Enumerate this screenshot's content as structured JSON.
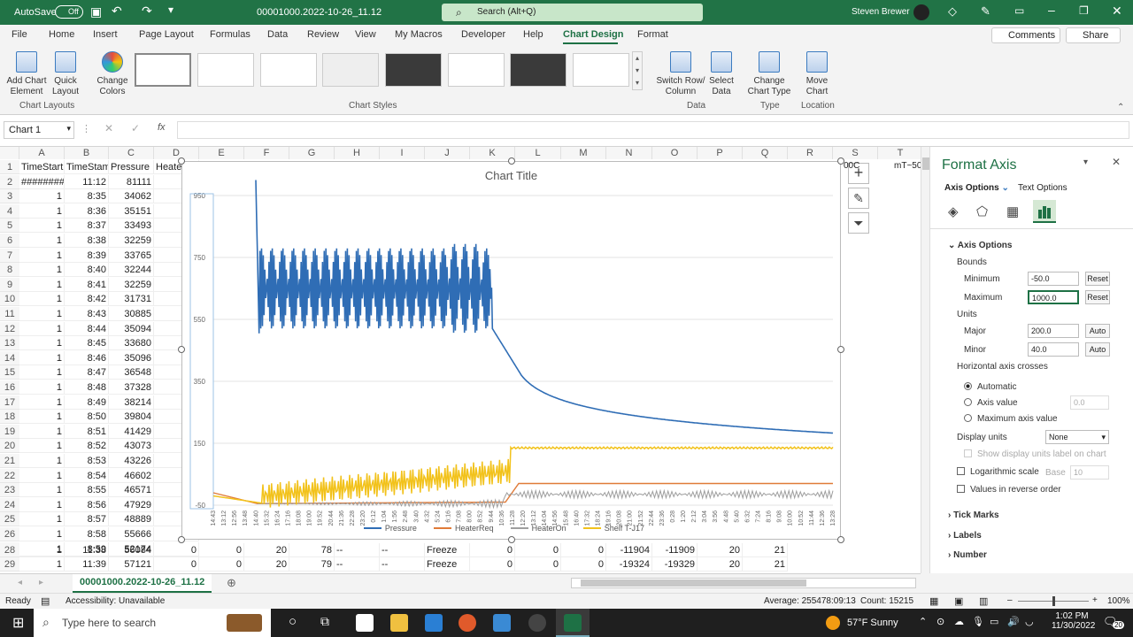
{
  "titlebar": {
    "autosave_label": "AutoSave",
    "autosave_state": "Off",
    "filename": "00001000.2022-10-26_11.12",
    "search_placeholder": "Search (Alt+Q)",
    "user": "Steven Brewer"
  },
  "ribbon_tabs": [
    "File",
    "Home",
    "Insert",
    "Page Layout",
    "Formulas",
    "Data",
    "Review",
    "View",
    "My Macros",
    "Developer",
    "Help",
    "Chart Design",
    "Format"
  ],
  "ribbon_actions": {
    "comments": "Comments",
    "share": "Share"
  },
  "ribbon": {
    "add_chart_element": "Add Chart Element",
    "quick_layout": "Quick Layout",
    "change_colors": "Change Colors",
    "switch_row_col": "Switch Row/ Column",
    "select_data": "Select Data",
    "change_chart_type": "Change Chart Type",
    "move_chart": "Move Chart",
    "group_chart_layouts": "Chart Layouts",
    "group_chart_styles": "Chart Styles",
    "group_data": "Data",
    "group_type": "Type",
    "group_location": "Location"
  },
  "formula": {
    "namebox": "Chart 1",
    "fx": "fx"
  },
  "columns": [
    "A",
    "B",
    "C",
    "D",
    "E",
    "F",
    "G",
    "H",
    "I",
    "J",
    "K",
    "L",
    "M",
    "N",
    "O",
    "P",
    "Q",
    "R",
    "S",
    "T"
  ],
  "rows": [
    [
      "1",
      "TimeStart",
      "TimeStam",
      "Pressure",
      "Heate"
    ],
    [
      "2",
      "########",
      "11:12",
      "81111",
      ""
    ],
    [
      "3",
      "1",
      "8:35",
      "34062",
      ""
    ],
    [
      "4",
      "1",
      "8:36",
      "35151",
      ""
    ],
    [
      "5",
      "1",
      "8:37",
      "33493",
      ""
    ],
    [
      "6",
      "1",
      "8:38",
      "32259",
      ""
    ],
    [
      "7",
      "1",
      "8:39",
      "33765",
      ""
    ],
    [
      "8",
      "1",
      "8:40",
      "32244",
      ""
    ],
    [
      "9",
      "1",
      "8:41",
      "32259",
      ""
    ],
    [
      "10",
      "1",
      "8:42",
      "31731",
      ""
    ],
    [
      "11",
      "1",
      "8:43",
      "30885",
      ""
    ],
    [
      "12",
      "1",
      "8:44",
      "35094",
      ""
    ],
    [
      "13",
      "1",
      "8:45",
      "33680",
      ""
    ],
    [
      "14",
      "1",
      "8:46",
      "35096",
      ""
    ],
    [
      "15",
      "1",
      "8:47",
      "36548",
      ""
    ],
    [
      "16",
      "1",
      "8:48",
      "37328",
      ""
    ],
    [
      "17",
      "1",
      "8:49",
      "38214",
      ""
    ],
    [
      "18",
      "1",
      "8:50",
      "39804",
      ""
    ],
    [
      "19",
      "1",
      "8:51",
      "41429",
      ""
    ],
    [
      "20",
      "1",
      "8:52",
      "43073",
      ""
    ],
    [
      "21",
      "1",
      "8:53",
      "43226",
      ""
    ],
    [
      "22",
      "1",
      "8:54",
      "46602",
      ""
    ],
    [
      "23",
      "1",
      "8:55",
      "46571",
      ""
    ],
    [
      "24",
      "1",
      "8:56",
      "47929",
      ""
    ],
    [
      "25",
      "1",
      "8:57",
      "48889",
      ""
    ],
    [
      "26",
      "1",
      "8:58",
      "55666",
      ""
    ],
    [
      "27",
      "1",
      "8:59",
      "52174",
      ""
    ]
  ],
  "bottom_rows": [
    [
      "28",
      "1",
      "11:38",
      "56084",
      "0",
      "0",
      "20",
      "78",
      "--",
      "--",
      "Freeze",
      "0",
      "0",
      "0",
      "-11904",
      "-11909",
      "20",
      "21"
    ],
    [
      "29",
      "1",
      "11:39",
      "57121",
      "0",
      "0",
      "20",
      "79",
      "--",
      "--",
      "Freeze",
      "0",
      "0",
      "0",
      "-19324",
      "-19329",
      "20",
      "21"
    ]
  ],
  "right_cells": {
    "s1": "00C",
    "t1": "mT~50"
  },
  "chart_data": {
    "type": "line",
    "title": "Chart Title",
    "ylim": [
      -50,
      1000
    ],
    "yticks": [
      "950",
      "750",
      "550",
      "350",
      "150",
      "-50"
    ],
    "xticks": [
      "14:43",
      "13:12",
      "12:56",
      "13:48",
      "14:40",
      "15:32",
      "16:24",
      "17:16",
      "18:08",
      "19:00",
      "19:52",
      "20:44",
      "21:36",
      "22:28",
      "23:20",
      "0:12",
      "1:04",
      "1:56",
      "2:48",
      "3:40",
      "4:32",
      "5:24",
      "6:16",
      "7:08",
      "8:00",
      "8:52",
      "9:44",
      "10:36",
      "11:28",
      "12:20",
      "13:12",
      "14:04",
      "14:56",
      "15:48",
      "16:40",
      "17:32",
      "18:24",
      "19:16",
      "20:08",
      "21:00",
      "21:52",
      "22:44",
      "23:36",
      "0:28",
      "1:20",
      "2:12",
      "3:04",
      "3:56",
      "4:48",
      "5:40",
      "6:32",
      "7:24",
      "8:16",
      "9:08",
      "10:00",
      "10:52",
      "11:44",
      "12:36",
      "13:28"
    ],
    "series": [
      {
        "name": "Pressure",
        "color": "#2f6db5"
      },
      {
        "name": "HeaterReq",
        "color": "#e07b39"
      },
      {
        "name": "HeaterOn",
        "color": "#9e9e9e"
      },
      {
        "name": "Shelf T-J17",
        "color": "#f2c21b"
      }
    ]
  },
  "pane": {
    "title": "Format Axis",
    "tab_axis": "Axis Options",
    "tab_text": "Text Options",
    "section": "Axis Options",
    "bounds": "Bounds",
    "minimum_label": "Minimum",
    "minimum_value": "-50.0",
    "maximum_label": "Maximum",
    "maximum_value": "1000.0",
    "reset": "Reset",
    "units": "Units",
    "major_label": "Major",
    "major_value": "200.0",
    "minor_label": "Minor",
    "minor_value": "40.0",
    "auto": "Auto",
    "h_axis_crosses": "Horizontal axis crosses",
    "automatic": "Automatic",
    "axis_value": "Axis value",
    "axis_value_input": "0.0",
    "max_axis_value": "Maximum axis value",
    "display_units": "Display units",
    "display_units_value": "None",
    "show_units_label": "Show display units label on chart",
    "log_scale": "Logarithmic scale",
    "base": "Base",
    "base_value": "10",
    "reverse": "Values in reverse order",
    "tick_marks": "Tick Marks",
    "labels": "Labels",
    "number": "Number"
  },
  "sheet_tab": "00001000.2022-10-26_11.12",
  "status": {
    "ready": "Ready",
    "accessibility": "Accessibility: Unavailable",
    "average": "Average: 255478:09:13",
    "count": "Count: 15215",
    "zoom": "100%"
  },
  "taskbar": {
    "search": "Type here to search",
    "weather": "57°F  Sunny",
    "time": "1:02 PM",
    "date": "11/30/2022",
    "notif": "20"
  }
}
